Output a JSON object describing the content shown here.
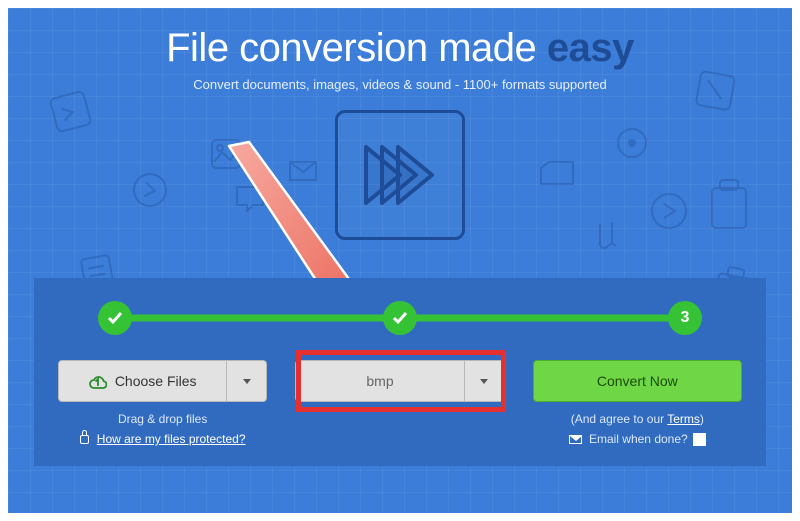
{
  "header": {
    "title_pre": "File conversion made ",
    "title_em": "easy",
    "subtitle": "Convert documents, images, videos & sound - 1100+ formats supported"
  },
  "stepper": {
    "step3_label": "3"
  },
  "choose": {
    "button_label": "Choose Files",
    "hint1": "Drag & drop files",
    "hint2_link": "How are my files protected?"
  },
  "format": {
    "selected": "bmp"
  },
  "convert": {
    "button_label": "Convert Now",
    "agree_pre": "(And agree to our ",
    "agree_link": "Terms",
    "agree_post": ")",
    "email_label": "Email when done?"
  },
  "colors": {
    "accent_green": "#6fd646",
    "step_green": "#35c335",
    "annotation_red": "#e63030"
  }
}
